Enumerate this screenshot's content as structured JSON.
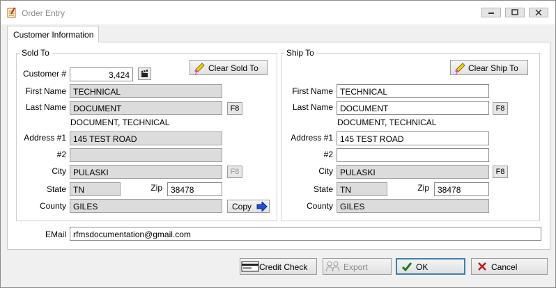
{
  "window": {
    "title": "Order Entry"
  },
  "tabs": [
    {
      "label": "Customer Information"
    }
  ],
  "sold_to": {
    "group_label": "Sold To",
    "customer_label": "Customer #",
    "customer_value": "3,424",
    "clear_button": "Clear Sold To",
    "first_name_label": "First Name",
    "first_name": "TECHNICAL",
    "last_name_label": "Last Name",
    "last_name": "DOCUMENT",
    "f8_label": "F8",
    "full_name": "DOCUMENT, TECHNICAL",
    "address1_label": "Address #1",
    "address1": "145 TEST ROAD",
    "address2_label": "#2",
    "address2": "",
    "city_label": "City",
    "city": "PULASKI",
    "state_label": "State",
    "state": "TN",
    "zip_label": "Zip",
    "zip": "38478",
    "county_label": "County",
    "county": "GILES",
    "copy_button": "Copy"
  },
  "ship_to": {
    "group_label": "Ship To",
    "clear_button": "Clear Ship To",
    "first_name_label": "First Name",
    "first_name": "TECHNICAL",
    "last_name_label": "Last Name",
    "last_name": "DOCUMENT",
    "f8_label": "F8",
    "full_name": "DOCUMENT, TECHNICAL",
    "address1_label": "Address #1",
    "address1": "145 TEST ROAD",
    "address2_label": "#2",
    "address2": "",
    "city_label": "City",
    "city": "PULASKI",
    "state_label": "State",
    "state": "TN",
    "zip_label": "Zip",
    "zip": "38478",
    "county_label": "County",
    "county": "GILES"
  },
  "email": {
    "label": "EMail",
    "value": "rfmsdocumentation@gmail.com"
  },
  "buttons": {
    "credit_check": "Credit Check",
    "export": "Export",
    "ok": "OK",
    "cancel": "Cancel"
  },
  "colors": {
    "readonly_field": "#dcdcdc",
    "ok_check": "#1a7a1a",
    "cancel_x": "#c01818",
    "copy_arrow": "#1f4fd8",
    "default_border": "#3c7fb1"
  }
}
